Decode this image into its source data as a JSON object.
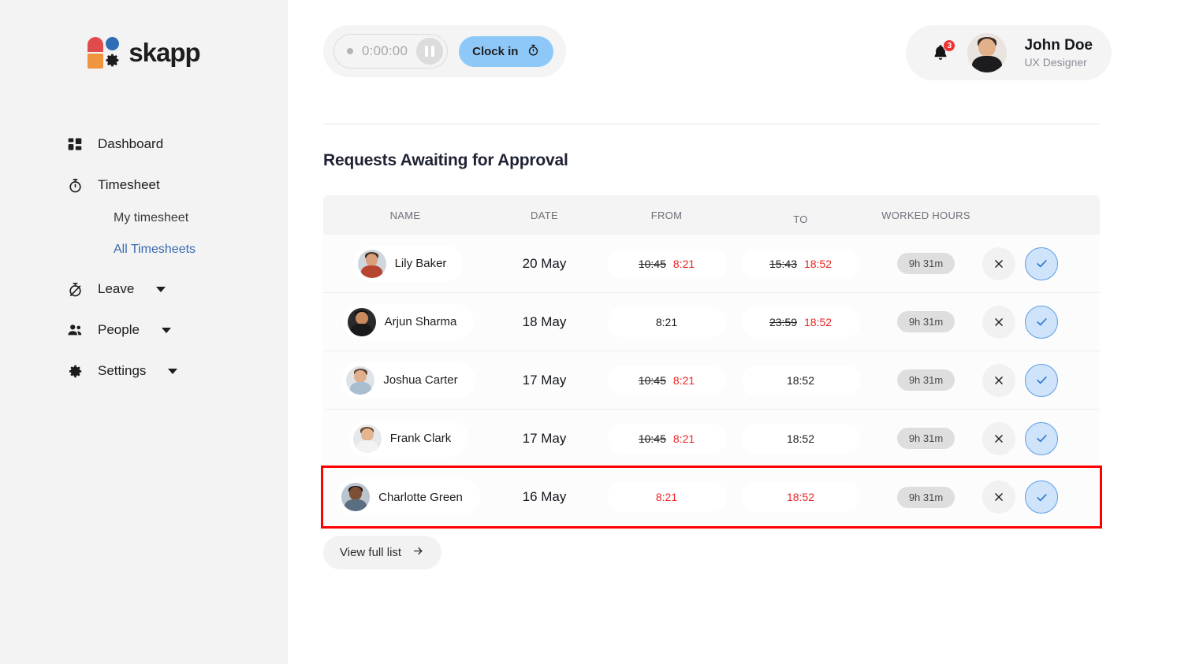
{
  "brand": {
    "name": "skapp",
    "logo_icon": "skapp-logo-icon"
  },
  "sidebar": {
    "items": [
      {
        "label": "Dashboard",
        "icon": "grid-icon",
        "has_caret": false
      },
      {
        "label": "Timesheet",
        "icon": "stopwatch-icon",
        "has_caret": false
      },
      {
        "label": "Leave",
        "icon": "stopwatch-off-icon",
        "has_caret": true
      },
      {
        "label": "People",
        "icon": "people-icon",
        "has_caret": true
      },
      {
        "label": "Settings",
        "icon": "gear-icon",
        "has_caret": true
      }
    ],
    "sub_items": [
      {
        "label": "My timesheet",
        "active": false
      },
      {
        "label": "All Timesheets",
        "active": true
      }
    ],
    "active_color": "#3a6bb0"
  },
  "topbar": {
    "timer_value": "0:00:00",
    "pause_icon": "pause-icon",
    "clock_in_label": "Clock in",
    "clock_in_icon": "stopwatch-icon",
    "clock_in_color": "#8ec8f8",
    "notification_icon": "bell-icon",
    "notification_count": "3",
    "notification_color": "#ef3333",
    "user_name": "John Doe",
    "user_role": "UX Designer"
  },
  "main": {
    "section_title": "Requests Awaiting for Approval",
    "view_full_list_label": "View full list",
    "view_full_list_icon": "arrow-right-icon"
  },
  "table": {
    "headers": [
      "NAME",
      "DATE",
      "FROM",
      "TO",
      "WORKED HOURS"
    ],
    "strike_color": "#1d1d1f",
    "edited_color": "#ee2222",
    "highlight_color": "#ff0000",
    "rows": [
      {
        "name": "Lily Baker",
        "date": "20 May",
        "from_old": "10:45",
        "from_new": "8:21",
        "to_old": "15:43",
        "to_new": "18:52",
        "worked_hours": "9h 31m",
        "highlighted": false
      },
      {
        "name": "Arjun Sharma",
        "date": "18 May",
        "from_old": "",
        "from_new": "",
        "from_plain": "8:21",
        "to_old": "23:59",
        "to_new": "18:52",
        "worked_hours": "9h 31m",
        "highlighted": false
      },
      {
        "name": "Joshua Carter",
        "date": "17 May",
        "from_old": "10:45",
        "from_new": "8:21",
        "to_old": "",
        "to_new": "",
        "to_plain": "18:52",
        "worked_hours": "9h 31m",
        "highlighted": false
      },
      {
        "name": "Frank Clark",
        "date": "17 May",
        "from_old": "10:45",
        "from_new": "8:21",
        "to_old": "",
        "to_new": "",
        "to_plain": "18:52",
        "worked_hours": "9h 31m",
        "highlighted": false
      },
      {
        "name": "Charlotte Green",
        "date": "16 May",
        "from_old": "",
        "from_new": "8:21",
        "to_old": "",
        "to_new": "18:52",
        "worked_hours": "9h 31m",
        "highlighted": true
      }
    ],
    "action_reject_icon": "close-icon",
    "action_approve_icon": "check-icon"
  }
}
